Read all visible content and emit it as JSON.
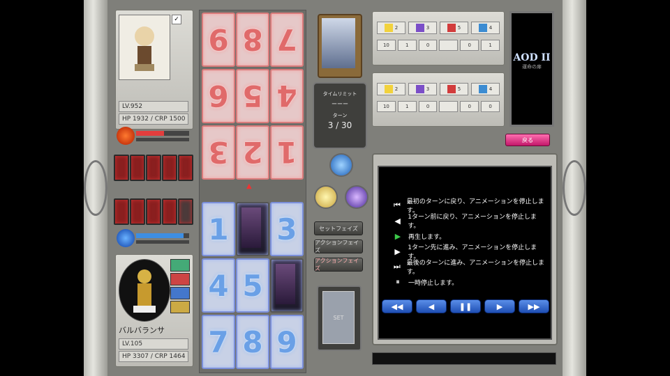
{
  "window": {
    "title": ""
  },
  "player_top": {
    "level": "LV.952",
    "hp": "HP 1932 / CRP 1500",
    "hand_count": 5
  },
  "player_bottom": {
    "name": "バルバランサ",
    "level": "LV.105",
    "hp": "HP 3307 / CRP 1464",
    "hand_count": 5,
    "portrait_label": ""
  },
  "board": {
    "opponent_cards": [
      "9",
      "8",
      "7",
      "6",
      "5",
      "4",
      "3",
      "2",
      "1"
    ],
    "player_cards": [
      "1",
      "",
      "3",
      "4",
      "5",
      "",
      "7",
      "8",
      "9"
    ]
  },
  "center": {
    "time_limit_label": "タイムリミット",
    "time_limit_value": "ーーー",
    "turn_label": "ターン",
    "turn_value": "3 / 30",
    "phase_set": "セットフェイズ",
    "phase_action1": "アクションフェイズ",
    "phase_action2": "アクションフェイズ",
    "set_slot": "SET"
  },
  "stats_top": {
    "row1": [
      "2",
      "3",
      "5",
      "4"
    ],
    "row2": [
      "10",
      "1",
      "0",
      "",
      "0",
      "1"
    ]
  },
  "stats_bottom": {
    "row1": [
      "2",
      "3",
      "5",
      "4"
    ],
    "row2": [
      "10",
      "1",
      "0",
      "",
      "0",
      "0"
    ]
  },
  "logo": {
    "text": "AOD II",
    "subtitle": "運命の扉"
  },
  "return_button": "戻る",
  "help": {
    "lines": [
      {
        "icon": "⏮",
        "text": "最初のターンに戻り、アニメーションを停止します。"
      },
      {
        "icon": "◀",
        "text": "1ターン前に戻り、アニメーションを停止します。"
      },
      {
        "icon": "▶",
        "text": "再生します。"
      },
      {
        "icon": "▶",
        "text": "1ターン先に進み、アニメーションを停止します。"
      },
      {
        "icon": "⏭",
        "text": "最後のターンに進み、アニメーションを停止します。"
      },
      {
        "icon": "⏸",
        "text": "一時停止します。"
      }
    ]
  },
  "controls": {
    "first": "◀◀",
    "prev": "◀",
    "pause": "❚❚",
    "next": "▶",
    "last": "▶▶"
  },
  "colors": {
    "play_icon": "#3cc84a",
    "control_blue": "#2f62cf"
  }
}
